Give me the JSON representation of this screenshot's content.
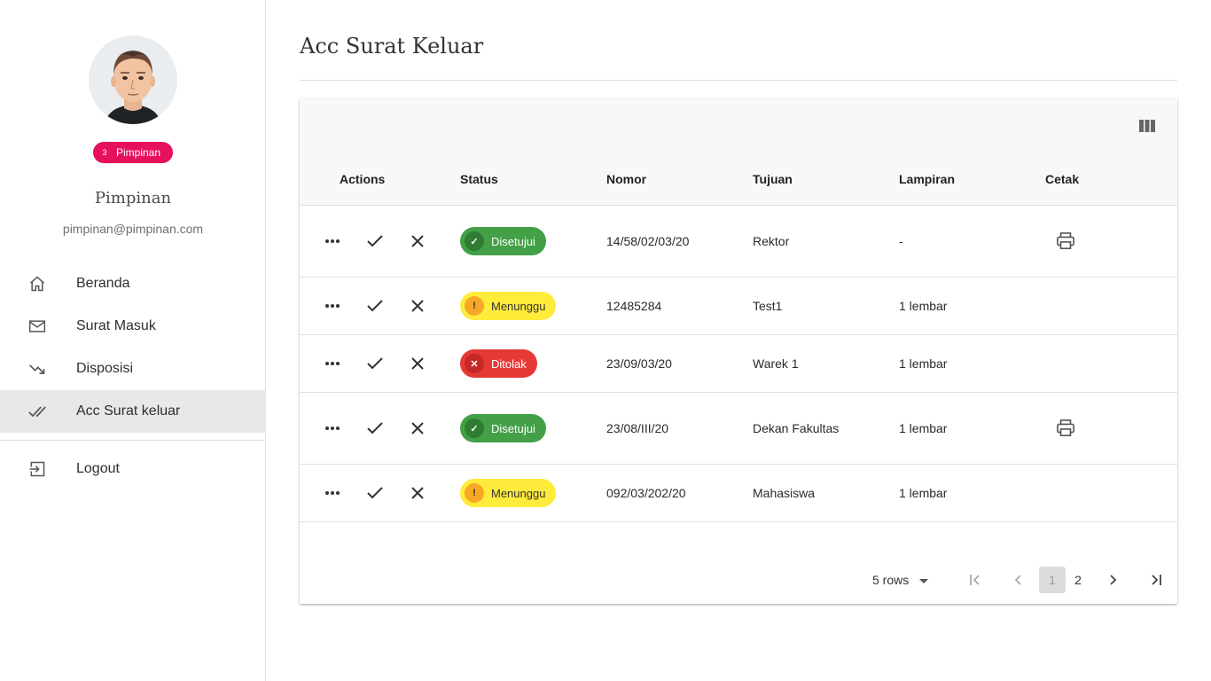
{
  "sidebar": {
    "badge_count": "3",
    "role_badge": "Pimpinan",
    "user_name": "Pimpinan",
    "user_email": "pimpinan@pimpinan.com",
    "nav": [
      {
        "label": "Beranda",
        "icon": "home-icon"
      },
      {
        "label": "Surat Masuk",
        "icon": "mail-icon"
      },
      {
        "label": "Disposisi",
        "icon": "trending-down-icon"
      },
      {
        "label": "Acc Surat keluar",
        "icon": "double-check-icon",
        "active": true
      },
      {
        "label": "Logout",
        "icon": "logout-icon"
      }
    ]
  },
  "main": {
    "title": "Acc Surat Keluar",
    "table": {
      "columns": [
        "Actions",
        "Status",
        "Nomor",
        "Tujuan",
        "Lampiran",
        "Cetak"
      ],
      "rows": [
        {
          "status": "Disetujui",
          "status_type": "approved",
          "nomor": "14/58/02/03/20",
          "tujuan": "Rektor",
          "lampiran": "-",
          "cetak": true
        },
        {
          "status": "Menunggu",
          "status_type": "waiting",
          "nomor": "12485284",
          "tujuan": "Test1",
          "lampiran": "1 lembar",
          "cetak": false
        },
        {
          "status": "Ditolak",
          "status_type": "rejected",
          "nomor": "23/09/03/20",
          "tujuan": "Warek 1",
          "lampiran": "1 lembar",
          "cetak": false
        },
        {
          "status": "Disetujui",
          "status_type": "approved",
          "nomor": "23/08/III/20",
          "tujuan": "Dekan Fakultas",
          "lampiran": "1 lembar",
          "cetak": true
        },
        {
          "status": "Menunggu",
          "status_type": "waiting",
          "nomor": "092/03/202/20",
          "tujuan": "Mahasiswa",
          "lampiran": "1 lembar",
          "cetak": false
        }
      ]
    },
    "pagination": {
      "rows_per_page": "5 rows",
      "pages": [
        "1",
        "2"
      ],
      "current_page": "1"
    }
  },
  "colors": {
    "accent_badge": "#e6105c",
    "approved": "#43a047",
    "waiting": "#ffeb3b",
    "rejected": "#e53935"
  }
}
